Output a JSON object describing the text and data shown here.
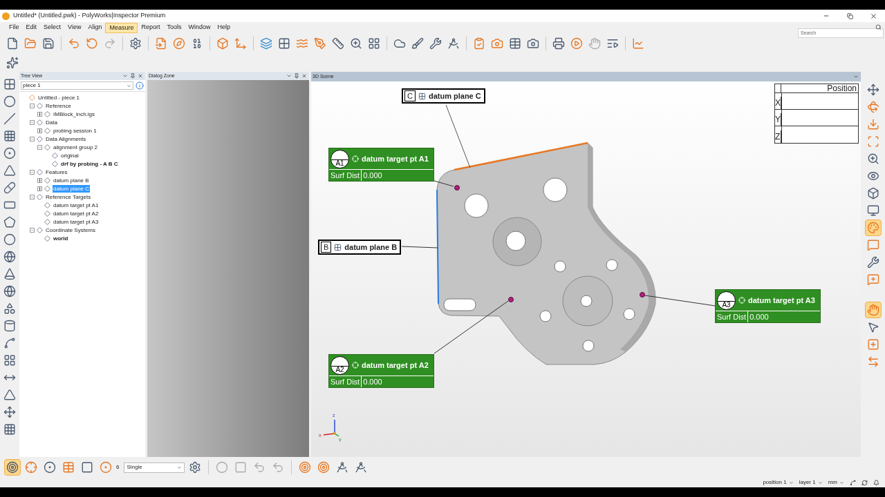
{
  "window": {
    "title": "Untitled* (Untitled.pwk) - PolyWorks|Inspector Premium",
    "search_placeholder": "Search"
  },
  "menu": [
    {
      "label": "File",
      "selected": false
    },
    {
      "label": "Edit",
      "selected": false
    },
    {
      "label": "Select",
      "selected": false
    },
    {
      "label": "View",
      "selected": false
    },
    {
      "label": "Align",
      "selected": false
    },
    {
      "label": "Measure",
      "selected": true
    },
    {
      "label": "Report",
      "selected": false
    },
    {
      "label": "Tools",
      "selected": false
    },
    {
      "label": "Window",
      "selected": false
    },
    {
      "label": "Help",
      "selected": false
    }
  ],
  "tree_view": {
    "title": "Tree View",
    "piece": "piece 1",
    "items": [
      {
        "label": "Untitled - piece 1",
        "selected": false,
        "active": false,
        "children": [
          {
            "label": "Reference",
            "expanded": true,
            "selected": false,
            "active": false,
            "children": [
              {
                "label": "IMBlock_inch.igs",
                "expanded": false,
                "selected": false,
                "active": false
              }
            ]
          },
          {
            "label": "Data",
            "expanded": true,
            "selected": false,
            "active": false,
            "children": [
              {
                "label": "probing session 1",
                "expanded": false,
                "selected": false,
                "active": false
              }
            ]
          },
          {
            "label": "Data Alignments",
            "expanded": true,
            "selected": false,
            "active": false,
            "children": [
              {
                "label": "alignment group 2",
                "expanded": true,
                "selected": false,
                "active": false,
                "children": [
                  {
                    "label": "original",
                    "selected": false,
                    "active": false
                  },
                  {
                    "label": "drf by probing - A B C",
                    "selected": false,
                    "active": true
                  }
                ]
              }
            ]
          },
          {
            "label": "Features",
            "expanded": true,
            "selected": false,
            "active": false,
            "children": [
              {
                "label": "datum plane B",
                "expanded": false,
                "selected": false,
                "active": false
              },
              {
                "label": "datum plane C",
                "expanded": false,
                "selected": true,
                "active": false
              }
            ]
          },
          {
            "label": "Reference Targets",
            "expanded": true,
            "selected": false,
            "active": false,
            "children": [
              {
                "label": "datum target pt A1",
                "selected": false,
                "active": false
              },
              {
                "label": "datum target pt A2",
                "selected": false,
                "active": false
              },
              {
                "label": "datum target pt A3",
                "selected": false,
                "active": false
              }
            ]
          },
          {
            "label": "Coordinate Systems",
            "expanded": true,
            "selected": false,
            "active": false,
            "children": [
              {
                "label": "world",
                "selected": false,
                "active": true
              }
            ]
          }
        ]
      }
    ]
  },
  "dialog_zone": {
    "title": "Dialog Zone"
  },
  "scene": {
    "title": "3D Scene",
    "callouts": [
      {
        "kind": "datum",
        "letter": "C",
        "title": "datum plane C"
      },
      {
        "kind": "target",
        "letter": "A1",
        "title": "datum target pt A1",
        "field": "Surf Dist",
        "value": "0.000"
      },
      {
        "kind": "datum",
        "letter": "B",
        "title": "datum plane B"
      },
      {
        "kind": "target",
        "letter": "A2",
        "title": "datum target pt A2",
        "field": "Surf Dist",
        "value": "0.000"
      },
      {
        "kind": "target",
        "letter": "A3",
        "title": "datum target pt A3",
        "field": "Surf Dist",
        "value": "0.000"
      }
    ],
    "position_table": {
      "header": "Position",
      "rows": [
        "X",
        "Y",
        "Z"
      ]
    },
    "axis_labels": {
      "z": "z",
      "x": "x",
      "y": "y"
    }
  },
  "right_toolbar": [
    {
      "pressed": false
    },
    {
      "pressed": false
    },
    {
      "pressed": false
    },
    {
      "pressed": false
    },
    {
      "pressed": false
    },
    {
      "pressed": false
    },
    {
      "pressed": false
    },
    {
      "pressed": false
    },
    {
      "pressed": true
    },
    {
      "pressed": false
    },
    {
      "pressed": false
    },
    {
      "pressed": false
    },
    {
      "pressed": true
    },
    {
      "pressed": false
    },
    {
      "pressed": false
    },
    {
      "pressed": false
    }
  ],
  "bottom_toolbar": {
    "buttons": [
      {
        "pressed": true
      },
      {
        "pressed": false
      },
      {
        "pressed": false
      },
      {
        "pressed": false
      },
      {
        "pressed": false
      }
    ],
    "count": "6",
    "mode": "Single"
  },
  "status_bar": [
    "position 1",
    "layer 1",
    "mm"
  ]
}
